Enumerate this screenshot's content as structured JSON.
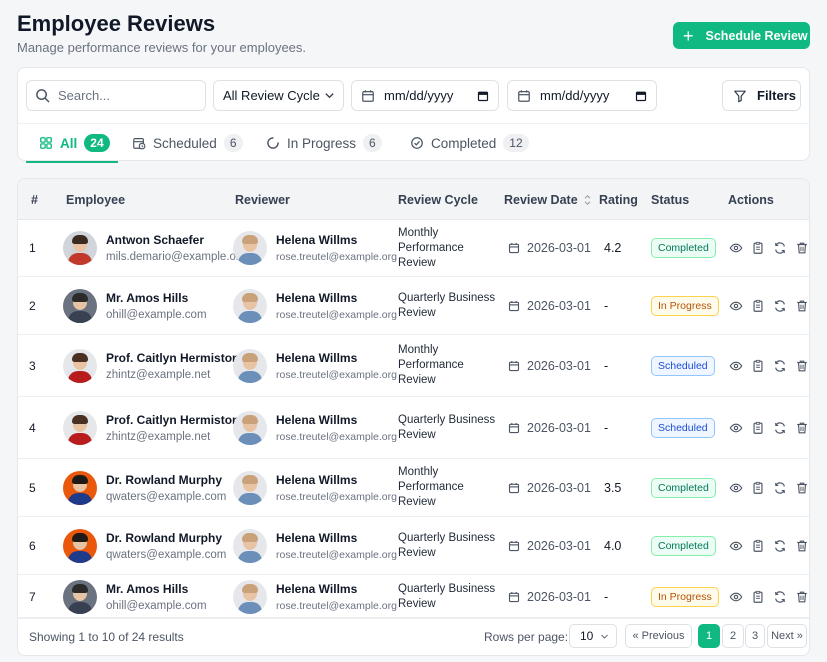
{
  "page": {
    "title": "Employee Reviews",
    "subtitle": "Manage performance reviews for your employees.",
    "primary_button": "Schedule Review"
  },
  "filters": {
    "search_placeholder": "Search...",
    "cycle_select": "All Review Cycle",
    "date_from": "mm/dd/yyyy",
    "date_to": "mm/dd/yyyy",
    "filters_button": "Filters"
  },
  "tabs": [
    {
      "label": "All",
      "count": "24",
      "icon": "grid-icon"
    },
    {
      "label": "Scheduled",
      "count": "6",
      "icon": "calendar-clock-icon"
    },
    {
      "label": "In Progress",
      "count": "6",
      "icon": "progress-spinner-icon"
    },
    {
      "label": "Completed",
      "count": "12",
      "icon": "check-circle-icon"
    }
  ],
  "table": {
    "columns": [
      "#",
      "Employee",
      "Reviewer",
      "Review Cycle",
      "Review Date",
      "Rating",
      "Status",
      "Actions"
    ],
    "rows": [
      {
        "num": "1",
        "employee": "Antwon Schaefer",
        "email": "mils.demario@example.org",
        "reviewer": "Helena Willms",
        "reviewer_email": "rose.treutel@example.org",
        "cycle1": "Monthly Performance",
        "cycle2": "Review",
        "date": "2026-03-01",
        "rating": "4.2",
        "status": "Completed"
      },
      {
        "num": "2",
        "employee": "Mr. Amos Hills",
        "email": "ohill@example.com",
        "reviewer": "Helena Willms",
        "reviewer_email": "rose.treutel@example.org",
        "cycle1": "Quarterly Business",
        "cycle2": "Review",
        "date": "2026-03-01",
        "rating": "-",
        "status": "In Progress"
      },
      {
        "num": "3",
        "employee": "Prof. Caitlyn Hermiston",
        "email": "zhintz@example.net",
        "reviewer": "Helena Willms",
        "reviewer_email": "rose.treutel@example.org",
        "cycle1": "Monthly Performance",
        "cycle2": "Review",
        "date": "2026-03-01",
        "rating": "-",
        "status": "Scheduled"
      },
      {
        "num": "4",
        "employee": "Prof. Caitlyn Hermiston",
        "email": "zhintz@example.net",
        "reviewer": "Helena Willms",
        "reviewer_email": "rose.treutel@example.org",
        "cycle1": "Quarterly Business",
        "cycle2": "Review",
        "date": "2026-03-01",
        "rating": "-",
        "status": "Scheduled"
      },
      {
        "num": "5",
        "employee": "Dr. Rowland Murphy",
        "email": "qwaters@example.com",
        "reviewer": "Helena Willms",
        "reviewer_email": "rose.treutel@example.org",
        "cycle1": "Monthly Performance",
        "cycle2": "Review",
        "date": "2026-03-01",
        "rating": "3.5",
        "status": "Completed"
      },
      {
        "num": "6",
        "employee": "Dr. Rowland Murphy",
        "email": "qwaters@example.com",
        "reviewer": "Helena Willms",
        "reviewer_email": "rose.treutel@example.org",
        "cycle1": "Quarterly Business",
        "cycle2": "Review",
        "date": "2026-03-01",
        "rating": "4.0",
        "status": "Completed"
      },
      {
        "num": "7",
        "employee": "Mr. Amos Hills",
        "email": "ohill@example.com",
        "reviewer": "Helena Willms",
        "reviewer_email": "rose.treutel@example.org",
        "cycle1": "Quarterly Business",
        "cycle2": "Review",
        "date": "2026-03-01",
        "rating": "-",
        "status": "In Progress"
      }
    ]
  },
  "footer": {
    "showing": "Showing 1 to 10 of 24 results",
    "rows_per_page_label": "Rows per page:",
    "rows_per_page": "10",
    "prev": "« Previous",
    "pages": [
      "1",
      "2",
      "3"
    ],
    "next": "Next »"
  },
  "colors": {
    "accent": "#10b981",
    "completed": "#10b981",
    "in_progress": "#d97706",
    "scheduled": "#2563eb"
  }
}
